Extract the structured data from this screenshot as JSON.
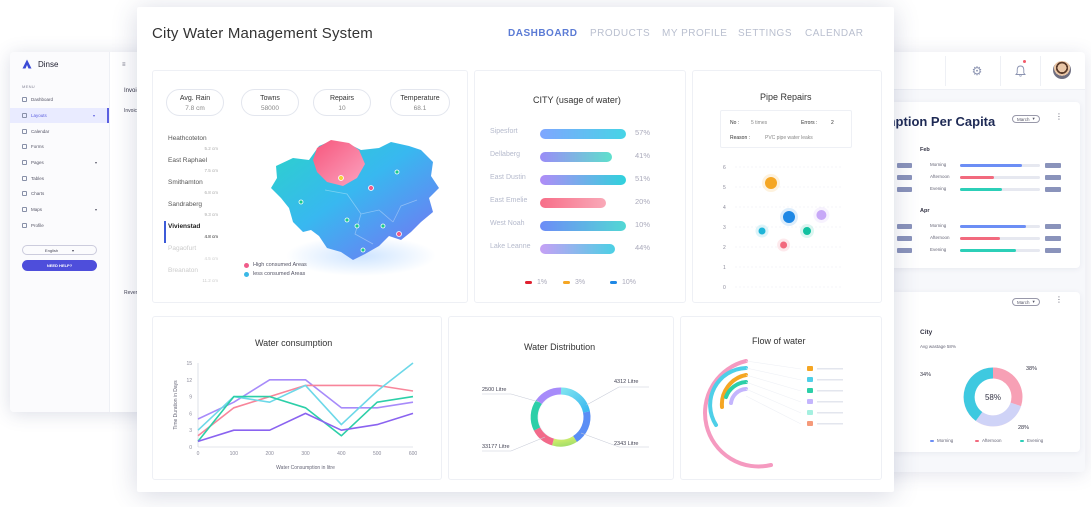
{
  "bg_left": {
    "brand": "Dinse",
    "menu_label": "MENU",
    "menu": [
      {
        "label": "Dashboard",
        "caret": ""
      },
      {
        "label": "Layouts",
        "caret": "▾"
      },
      {
        "label": "Calendar",
        "caret": ""
      },
      {
        "label": "Forms",
        "caret": ""
      },
      {
        "label": "Pages",
        "caret": "▾"
      },
      {
        "label": "Tables",
        "caret": ""
      },
      {
        "label": "Charts",
        "caret": ""
      },
      {
        "label": "Maps",
        "caret": "▾"
      },
      {
        "label": "Profile",
        "caret": ""
      }
    ],
    "language": "English",
    "help_button": "NEED HELP?",
    "invoice_title": "Invoice",
    "invoice_sub": "Invoice S",
    "revenue": "Revenue"
  },
  "bg_right": {
    "consumption_title": "mption Per Capita",
    "month_label": "March",
    "feb_label": "Feb",
    "apr_label": "Apr",
    "rows": [
      "Morning",
      "Afternoon",
      "Evening"
    ],
    "city_title": "City",
    "city_sub": "Avg wastage 58%",
    "donut_center": "58%",
    "pct_left": "34%",
    "pct_top": "38%",
    "pct_bottom": "28%",
    "legend": [
      "Morning",
      "Afternoon",
      "Evening"
    ],
    "colors": {
      "morning": "#6c8ef5",
      "afternoon": "#f26a7e",
      "evening": "#2ccfb8"
    }
  },
  "header": {
    "title": "City Water Management System",
    "nav": [
      "DASHBOARD",
      "PRODUCTS",
      "MY PROFILE",
      "SETTINGS",
      "CALENDAR"
    ]
  },
  "stats": [
    {
      "label": "Avg. Rain",
      "value": "7.8 cm"
    },
    {
      "label": "Towns",
      "value": "58000"
    },
    {
      "label": "Repairs",
      "value": "10"
    },
    {
      "label": "Temperature",
      "value": "68.1"
    }
  ],
  "cities": [
    {
      "name": "Heathcoteton",
      "value": "5.2 cm"
    },
    {
      "name": "East Raphael",
      "value": "7.5 cm"
    },
    {
      "name": "Smithamton",
      "value": "6.8 cm"
    },
    {
      "name": "Sandraberg",
      "value": "9.3 cm"
    },
    {
      "name": "Vivienstad",
      "value": "4.8 cm"
    },
    {
      "name": "Pagaofurt",
      "value": "4.5 cm"
    },
    {
      "name": "Breanaton",
      "value": "11.2 cm"
    }
  ],
  "map_legend": [
    "High consumed Areas",
    "less consumed Areas"
  ],
  "usage": {
    "title": "CITY (usage of water)",
    "rows": [
      {
        "name": "Sipesfort",
        "pct": "57%",
        "value": 57
      },
      {
        "name": "Dellaberg",
        "pct": "41%",
        "value": 41
      },
      {
        "name": "East Dustin",
        "pct": "51%",
        "value": 51
      },
      {
        "name": "East Emelie",
        "pct": "20%",
        "value": 20
      },
      {
        "name": "West Noah",
        "pct": "10%",
        "value": 10
      },
      {
        "name": "Lake Leanne",
        "pct": "44%",
        "value": 44
      }
    ],
    "legend": [
      {
        "label": "1%",
        "color": "#e0202f"
      },
      {
        "label": "3%",
        "color": "#f5a623"
      },
      {
        "label": "10%",
        "color": "#1e88e5"
      }
    ]
  },
  "repairs": {
    "title": "Pipe Repairs",
    "no_label": "No :",
    "no_value": "5 times",
    "errors_label": "Errors :",
    "errors_value": "2",
    "reason_label": "Reason :",
    "reason_value": "PVC pipe water leaks",
    "y_ticks": [
      "6",
      "5",
      "4",
      "3",
      "2",
      "1",
      "0"
    ]
  },
  "consumption": {
    "title": "Water consumption",
    "ylabel": "Time Duration in Days",
    "xlabel": "Water Consumption in litre",
    "y_ticks": [
      "15",
      "12",
      "9",
      "6",
      "3",
      "0"
    ],
    "x_ticks": [
      "0",
      "100",
      "200",
      "300",
      "400",
      "500",
      "600"
    ]
  },
  "distribution": {
    "title": "Water Distribution",
    "labels": [
      "2500 Litre",
      "4312 Litre",
      "33177 Litre",
      "2343 Litre"
    ]
  },
  "flow": {
    "title": "Flow of water"
  },
  "chart_data": [
    {
      "type": "line",
      "title": "Water consumption",
      "xlabel": "Water Consumption in litre",
      "ylabel": "Time Duration in Days",
      "x": [
        0,
        100,
        200,
        300,
        400,
        500,
        600
      ],
      "xlim": [
        0,
        600
      ],
      "ylim": [
        0,
        15
      ],
      "series": [
        {
          "color": "#a78bfa",
          "values": [
            5,
            8,
            12,
            12,
            7,
            7,
            8
          ]
        },
        {
          "color": "#f8859a",
          "values": [
            2,
            7,
            9,
            11,
            11,
            11,
            10
          ]
        },
        {
          "color": "#6dd8e8",
          "values": [
            3,
            9,
            8,
            11,
            4,
            10,
            15
          ]
        },
        {
          "color": "#2ccfa8",
          "values": [
            1,
            9,
            9,
            7,
            2,
            8,
            9
          ]
        },
        {
          "color": "#8a63f0",
          "values": [
            1,
            3,
            3,
            6,
            3,
            4,
            6
          ]
        }
      ]
    },
    {
      "type": "scatter",
      "title": "Pipe Repairs",
      "ylim": [
        0,
        6
      ],
      "points": [
        {
          "x": 2.0,
          "y": 5.2,
          "size": 6,
          "color": "#f5a623"
        },
        {
          "x": 1.5,
          "y": 2.8,
          "size": 3.5,
          "color": "#1eb5d8"
        },
        {
          "x": 3.0,
          "y": 3.5,
          "size": 6,
          "color": "#1e88e5"
        },
        {
          "x": 2.7,
          "y": 2.1,
          "size": 3.5,
          "color": "#f26a7e"
        },
        {
          "x": 4.0,
          "y": 2.8,
          "size": 4,
          "color": "#12c1a0"
        },
        {
          "x": 4.8,
          "y": 3.6,
          "size": 5,
          "color": "#c7a8f7"
        }
      ]
    },
    {
      "type": "pie",
      "title": "Water Distribution",
      "values": [
        2500,
        4312,
        33177,
        2343
      ]
    }
  ]
}
